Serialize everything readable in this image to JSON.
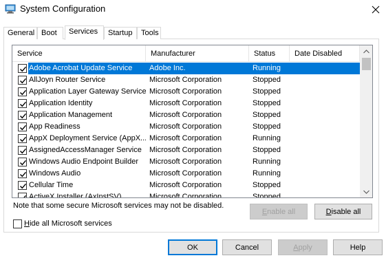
{
  "window": {
    "title": "System Configuration"
  },
  "tabs": [
    {
      "label": "General"
    },
    {
      "label": "Boot"
    },
    {
      "label": "Services"
    },
    {
      "label": "Startup"
    },
    {
      "label": "Tools"
    }
  ],
  "active_tab": "Services",
  "columns": {
    "service": "Service",
    "manufacturer": "Manufacturer",
    "status": "Status",
    "date_disabled": "Date Disabled"
  },
  "services": [
    {
      "name": "Adobe Acrobat Update Service",
      "manufacturer": "Adobe Inc.",
      "status": "Running",
      "date_disabled": "",
      "checked": true,
      "selected": true
    },
    {
      "name": "AllJoyn Router Service",
      "manufacturer": "Microsoft Corporation",
      "status": "Stopped",
      "date_disabled": "",
      "checked": true
    },
    {
      "name": "Application Layer Gateway Service",
      "manufacturer": "Microsoft Corporation",
      "status": "Stopped",
      "date_disabled": "",
      "checked": true
    },
    {
      "name": "Application Identity",
      "manufacturer": "Microsoft Corporation",
      "status": "Stopped",
      "date_disabled": "",
      "checked": true
    },
    {
      "name": "Application Management",
      "manufacturer": "Microsoft Corporation",
      "status": "Stopped",
      "date_disabled": "",
      "checked": true
    },
    {
      "name": "App Readiness",
      "manufacturer": "Microsoft Corporation",
      "status": "Stopped",
      "date_disabled": "",
      "checked": true
    },
    {
      "name": "AppX Deployment Service (AppX...",
      "manufacturer": "Microsoft Corporation",
      "status": "Running",
      "date_disabled": "",
      "checked": true
    },
    {
      "name": "AssignedAccessManager Service",
      "manufacturer": "Microsoft Corporation",
      "status": "Stopped",
      "date_disabled": "",
      "checked": true
    },
    {
      "name": "Windows Audio Endpoint Builder",
      "manufacturer": "Microsoft Corporation",
      "status": "Running",
      "date_disabled": "",
      "checked": true
    },
    {
      "name": "Windows Audio",
      "manufacturer": "Microsoft Corporation",
      "status": "Running",
      "date_disabled": "",
      "checked": true
    },
    {
      "name": "Cellular Time",
      "manufacturer": "Microsoft Corporation",
      "status": "Stopped",
      "date_disabled": "",
      "checked": true
    },
    {
      "name": "ActiveX Installer (AxInstSV)",
      "manufacturer": "Microsoft Corporation",
      "status": "Stopped",
      "date_disabled": "",
      "checked": true
    }
  ],
  "note": "Note that some secure Microsoft services may not be disabled.",
  "buttons": {
    "enable_all": "Enable all",
    "disable_all": "Disable all",
    "ok": "OK",
    "cancel": "Cancel",
    "apply": "Apply",
    "help": "Help"
  },
  "hide_ms": {
    "label": "Hide all Microsoft services",
    "checked": false
  },
  "colors": {
    "selection": "#0078d7",
    "default_button_border": "#0078d7",
    "disabled_text": "#a0a0a0"
  },
  "icons": {
    "app": "system-configuration-icon",
    "close": "close-icon",
    "check": "checkmark-icon",
    "scroll_up": "scroll-up-arrow-icon",
    "scroll_down": "scroll-down-arrow-icon"
  }
}
